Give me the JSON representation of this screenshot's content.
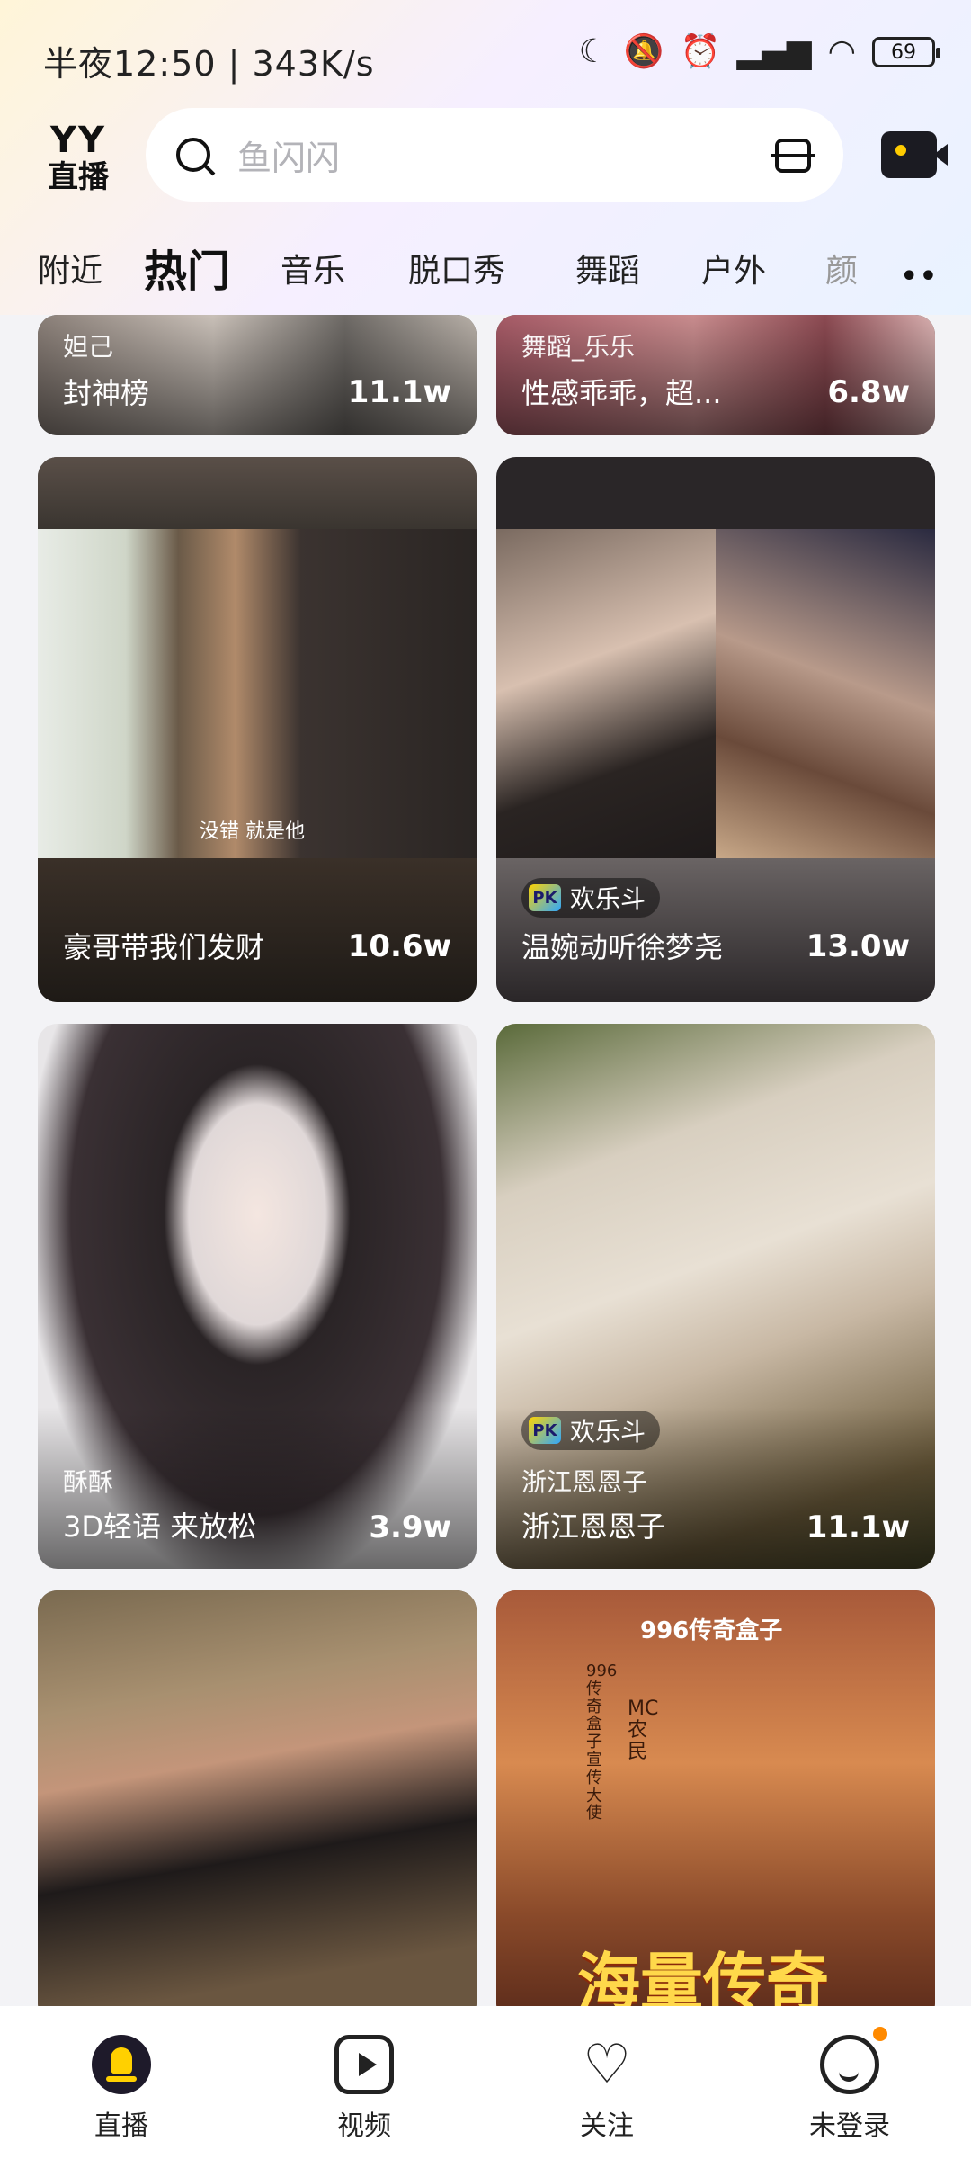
{
  "status_bar": {
    "time_speed": "半夜12:50 | 343K/s",
    "battery": "69"
  },
  "header": {
    "logo_line1": "YY",
    "logo_line2": "直播",
    "search_placeholder": "鱼闪闪"
  },
  "tabs": [
    {
      "label": "附近",
      "active": false
    },
    {
      "label": "热门",
      "active": true
    },
    {
      "label": "音乐",
      "active": false
    },
    {
      "label": "脱口秀",
      "active": false
    },
    {
      "label": "舞蹈",
      "active": false
    },
    {
      "label": "户外",
      "active": false
    },
    {
      "label": "颜",
      "active": false
    }
  ],
  "tab_more": "••",
  "cards": [
    {
      "sub": "妲己",
      "title": "封神榜",
      "count": "11.1w"
    },
    {
      "sub": "舞蹈_乐乐",
      "title": "性感乖乖，超...",
      "count": "6.8w"
    },
    {
      "title": "豪哥带我们发财",
      "count": "10.6w",
      "screen_text": "没错  就是他"
    },
    {
      "badge": "欢乐斗",
      "title": "温婉动听徐梦尧",
      "count": "13.0w"
    },
    {
      "sub": "酥酥",
      "title": "3D轻语 来放松",
      "count": "3.9w"
    },
    {
      "badge": "欢乐斗",
      "sub": "浙江恩恩子",
      "title": "浙江恩恩子",
      "count": "11.1w"
    },
    {},
    {
      "poster_brand": "996传奇盒子",
      "poster_vertical": "996传奇盒子宣传大使",
      "poster_name": "MC农民",
      "poster_big": "海量传奇"
    }
  ],
  "badge_logo": "PK",
  "bottom_nav": [
    {
      "label": "直播",
      "icon": "live-icon"
    },
    {
      "label": "视频",
      "icon": "video-icon"
    },
    {
      "label": "关注",
      "icon": "heart-icon"
    },
    {
      "label": "未登录",
      "icon": "user-icon"
    }
  ],
  "colors": {
    "accent": "#ffd000",
    "notification_dot": "#ff8a00"
  }
}
